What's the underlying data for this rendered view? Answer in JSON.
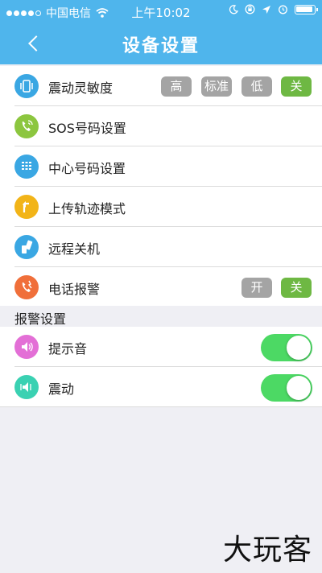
{
  "status_bar": {
    "carrier": "中国电信",
    "time": "上午10:02",
    "signal_dots_full": 4,
    "signal_dots_total": 5,
    "icons": [
      "wifi-icon",
      "moon-icon",
      "lock-rotation-icon",
      "location-arrow-icon",
      "alarm-icon",
      "battery-icon"
    ]
  },
  "nav": {
    "back_icon": "chevron-left-icon",
    "title": "设备设置"
  },
  "settings": [
    {
      "label": "震动灵敏度",
      "icon": "vibrate-phone-icon",
      "icon_color": "#3aa7e3",
      "options": [
        "高",
        "标准",
        "低",
        "关"
      ],
      "selected": "关"
    },
    {
      "label": "SOS号码设置",
      "icon": "phone-call-icon",
      "icon_color": "#8cc63f"
    },
    {
      "label": "中心号码设置",
      "icon": "dialpad-icon",
      "icon_color": "#3aa7e3"
    },
    {
      "label": "上传轨迹模式",
      "icon": "upload-arrow-icon",
      "icon_color": "#f2b418"
    },
    {
      "label": "远程关机",
      "icon": "remote-shutdown-icon",
      "icon_color": "#3aa7e3"
    },
    {
      "label": "电话报警",
      "icon": "phone-alarm-icon",
      "icon_color": "#f06f3a",
      "options": [
        "开",
        "关"
      ],
      "selected": "关"
    }
  ],
  "alarm_section": {
    "header": "报警设置",
    "items": [
      {
        "label": "提示音",
        "icon": "speaker-icon",
        "icon_color": "#e36fd6",
        "on": true
      },
      {
        "label": "震动",
        "icon": "vibration-speaker-icon",
        "icon_color": "#3ad1b2",
        "on": true
      }
    ]
  },
  "colors": {
    "header_bg": "#4fb5ec",
    "chip_selected": "#6eb843",
    "chip_unselected": "#a4a4a4",
    "toggle_on": "#4cd964"
  },
  "watermark": "大玩客"
}
